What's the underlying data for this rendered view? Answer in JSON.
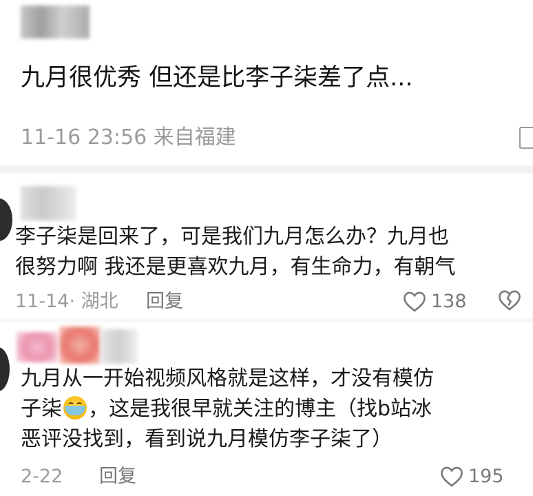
{
  "comments": [
    {
      "text": "九月很优秀  但还是比李子柒差了点...",
      "time": "11-16 23:56",
      "location": "来自福建"
    },
    {
      "line1": "李子柒是回来了，可是我们九月怎么办？九月也",
      "line2": "很努力啊 我还是更喜欢九月，有生命力，有朝气",
      "time": "11-14· 湖北",
      "reply": "回复",
      "likes": "138"
    },
    {
      "line1": "九月从一开始视频风格就是这样，才没有模仿",
      "line2_a": "子柒",
      "line2_b": "，这是我很早就关注的博主（找b站冰",
      "line3": "恶评没找到，看到说九月模仿李子柒了）",
      "time": "2-22",
      "reply": "回复",
      "likes": "195",
      "emoji": "loudly-crying-face"
    }
  ]
}
